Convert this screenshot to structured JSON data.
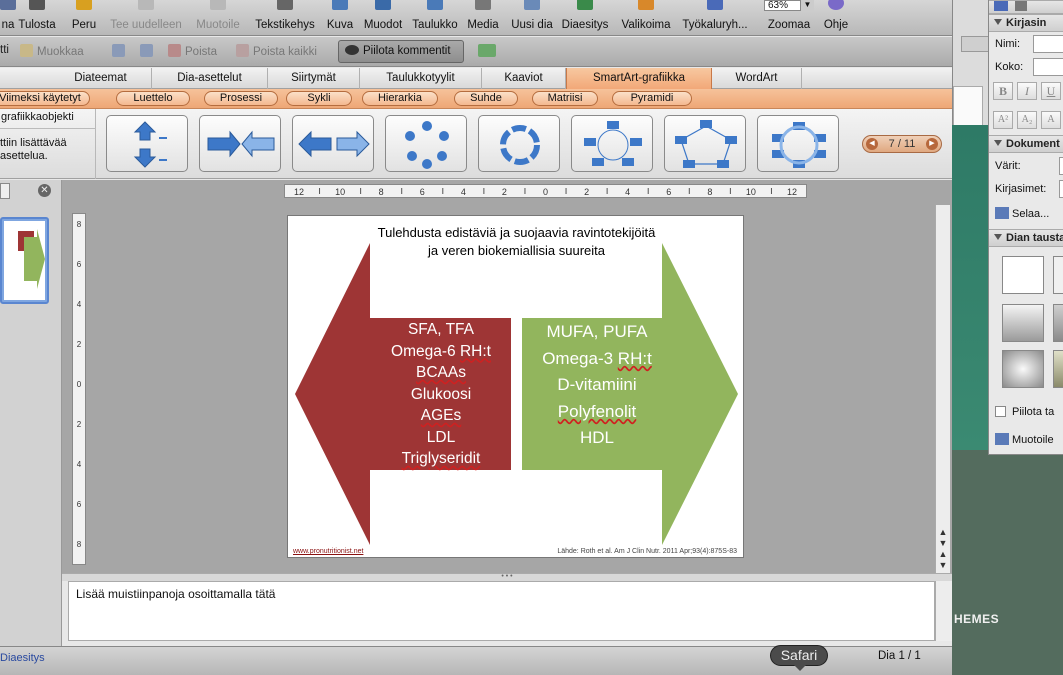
{
  "toolbar": {
    "items": [
      {
        "label": "na",
        "icon": "slide-icon"
      },
      {
        "label": "Tulosta",
        "icon": "printer-icon"
      },
      {
        "label": "Peru",
        "icon": "undo-icon"
      },
      {
        "label": "Tee uudelleen",
        "icon": "redo-icon"
      },
      {
        "label": "Muotoile",
        "icon": "format-painter-icon"
      },
      {
        "label": "Tekstikehys",
        "icon": "text-box-icon"
      },
      {
        "label": "Kuva",
        "icon": "picture-icon"
      },
      {
        "label": "Muodot",
        "icon": "shapes-icon"
      },
      {
        "label": "Taulukko",
        "icon": "table-icon"
      },
      {
        "label": "Media",
        "icon": "media-icon"
      },
      {
        "label": "Uusi dia",
        "icon": "new-slide-icon"
      },
      {
        "label": "Diaesitys",
        "icon": "slideshow-icon"
      },
      {
        "label": "Valikoima",
        "icon": "gallery-icon"
      },
      {
        "label": "Työkaluryh...",
        "icon": "toolbox-icon"
      },
      {
        "label": "Zoomaa",
        "icon": "zoom-icon"
      },
      {
        "label": "Ohje",
        "icon": "help-icon"
      }
    ],
    "zoom_value": "63%"
  },
  "comments_bar": {
    "items": [
      "tti",
      "Muokkaa",
      "Poista",
      "Poista kaikki"
    ],
    "hide_comments": "Piilota kommentit"
  },
  "ribbon_tabs": [
    "Diateemat",
    "Dia-asettelut",
    "Siirtymät",
    "Taulukkotyylit",
    "Kaaviot",
    "SmartArt-grafiikka",
    "WordArt"
  ],
  "active_tab": "SmartArt-grafiikka",
  "smartart_categories": [
    "Viimeksi käytetyt",
    "Luettelo",
    "Prosessi",
    "Sykli",
    "Hierarkia",
    "Suhde",
    "Matriisi",
    "Pyramidi"
  ],
  "gallery": {
    "header": "grafiikkaobjekti",
    "desc_line1": "ttiin lisättävää",
    "desc_line2": "asettelua.",
    "page_indicator": "7 / 11"
  },
  "ruler": {
    "h_ticks": [
      "12",
      "10",
      "8",
      "6",
      "4",
      "2",
      "0",
      "2",
      "4",
      "6",
      "8",
      "10",
      "12"
    ],
    "v_ticks": [
      "8",
      "6",
      "4",
      "2",
      "0",
      "2",
      "4",
      "6",
      "8"
    ]
  },
  "slide": {
    "title_line1": "Tulehdusta edistäviä ja suojaavia ravintotekijöitä",
    "title_line2": "ja veren biokemiallisia suureita",
    "left_items": [
      "SFA, TFA",
      "Omega-6 RH:t",
      "BCAAs",
      "Glukoosi",
      "AGEs",
      "LDL",
      "Triglyseridit"
    ],
    "right_items": [
      "MUFA, PUFA",
      "Omega-3 RH:t",
      "D-vitamiini",
      "Polyfenolit",
      "HDL"
    ],
    "url": "www.pronutritionist.net",
    "source": "Lähde: Roth et al. Am J Clin Nutr. 2011 Apr;93(4):875S-83",
    "left_color": "#9e3535",
    "right_color": "#92b55d"
  },
  "notes": {
    "placeholder": "Lisää muistiinpanoja osoittamalla tätä"
  },
  "status": {
    "view": "Diaesitys",
    "slide_counter": "Dia 1 / 1"
  },
  "dock_tooltip": "Safari",
  "desktop": {
    "themes_text": "HEMES"
  },
  "palette": {
    "font_header": "Kirjasin",
    "name_label": "Nimi:",
    "size_label": "Koko:",
    "doc_header": "Dokument",
    "colors_label": "Värit:",
    "fonts_label": "Kirjasimet:",
    "browse_label": "Selaa...",
    "bg_header": "Dian tausta",
    "hide_bg_label": "Piilota ta",
    "format_label": "Muotoile"
  }
}
